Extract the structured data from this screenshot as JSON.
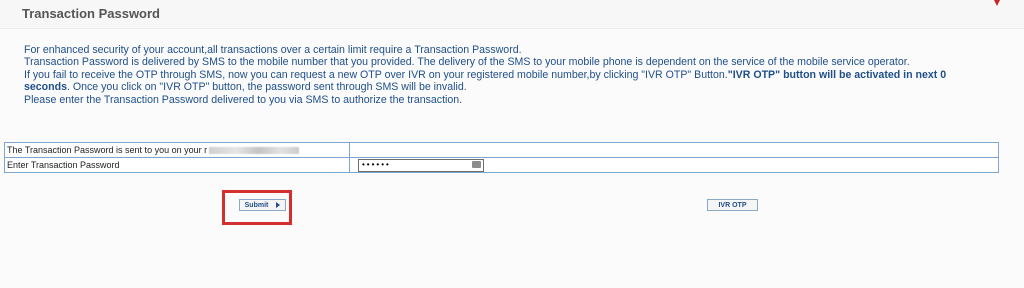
{
  "header": {
    "title": "Transaction Password"
  },
  "info": {
    "line1": "For enhanced security of your account,all transactions over a certain limit require a Transaction Password.",
    "line2": "Transaction Password is delivered by SMS to the mobile number that you provided. The delivery of the SMS to your mobile phone is dependent on the service of the mobile service operator.",
    "line3_normal": "If you fail to receive the OTP through SMS, now you can request a new OTP over IVR on your registered mobile number,by clicking \"IVR OTP\" Button.",
    "line3_bold": "\"IVR OTP\" button will be activated in next 0",
    "line4_bold": "seconds",
    "line4_normal": ". Once you click on \"IVR OTP\" button, the password sent through SMS will be invalid.",
    "line5": "Please enter the Transaction Password delivered to you via SMS to authorize the transaction."
  },
  "form": {
    "sent_label": "The Transaction Password is sent to you on your r",
    "password_label": "Enter Transaction Password",
    "password_value": "••••••"
  },
  "buttons": {
    "submit_label": "Submit",
    "ivr_label": "IVR OTP"
  },
  "colors": {
    "text_blue": "#1f4f8a",
    "border_blue": "#7fa6cf",
    "highlight_red": "#d32f2f"
  }
}
